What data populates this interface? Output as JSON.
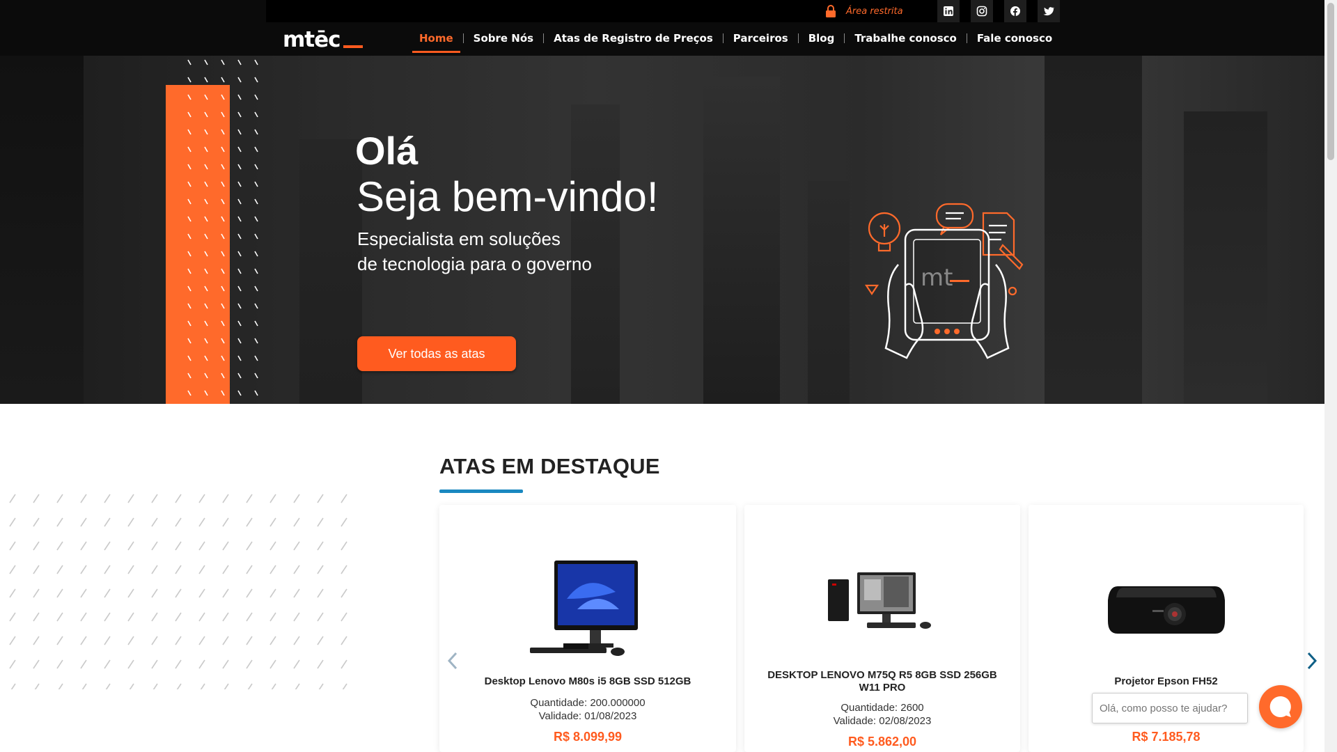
{
  "header": {
    "restricted_area": "Área restrita",
    "logo_text": "mtēc",
    "social": [
      {
        "icon": "linkedin-icon"
      },
      {
        "icon": "instagram-icon"
      },
      {
        "icon": "facebook-icon"
      },
      {
        "icon": "twitter-icon"
      }
    ],
    "nav": [
      {
        "label": "Home",
        "active": true
      },
      {
        "label": "Sobre Nós"
      },
      {
        "label": "Atas de Registro de Preços"
      },
      {
        "label": "Parceiros"
      },
      {
        "label": "Blog"
      },
      {
        "label": "Trabalhe conosco"
      },
      {
        "label": "Fale conosco"
      }
    ]
  },
  "hero": {
    "greeting": "Olá",
    "title": "Seja bem-vindo!",
    "subtitle_line1": "Especialista em soluções",
    "subtitle_line2": "de tecnologia para o governo",
    "cta": "Ver todas as atas",
    "illustration_text": "mt"
  },
  "section": {
    "title": "ATAS EM DESTAQUE"
  },
  "products": [
    {
      "name": "Desktop Lenovo M80s i5 8GB SSD 512GB",
      "quantity": "Quantidade: 200.000000",
      "validity": "Validade: 01/08/2023",
      "price": "R$ 8.099,99"
    },
    {
      "name": "DESKTOP LENOVO M75Q R5 8GB SSD 256GB W11 PRO",
      "quantity": "Quantidade: 2600",
      "validity": "Validade: 02/08/2023",
      "price": "R$ 5.862,00"
    },
    {
      "name": "Projetor Epson FH52",
      "price": "R$ 7.185,78"
    }
  ],
  "chat": {
    "placeholder": "Olá, como posso te ajudar?"
  },
  "colors": {
    "accent": "#ff5b1f",
    "underline": "#1a88c0",
    "header_bg": "#0b0b0b"
  }
}
